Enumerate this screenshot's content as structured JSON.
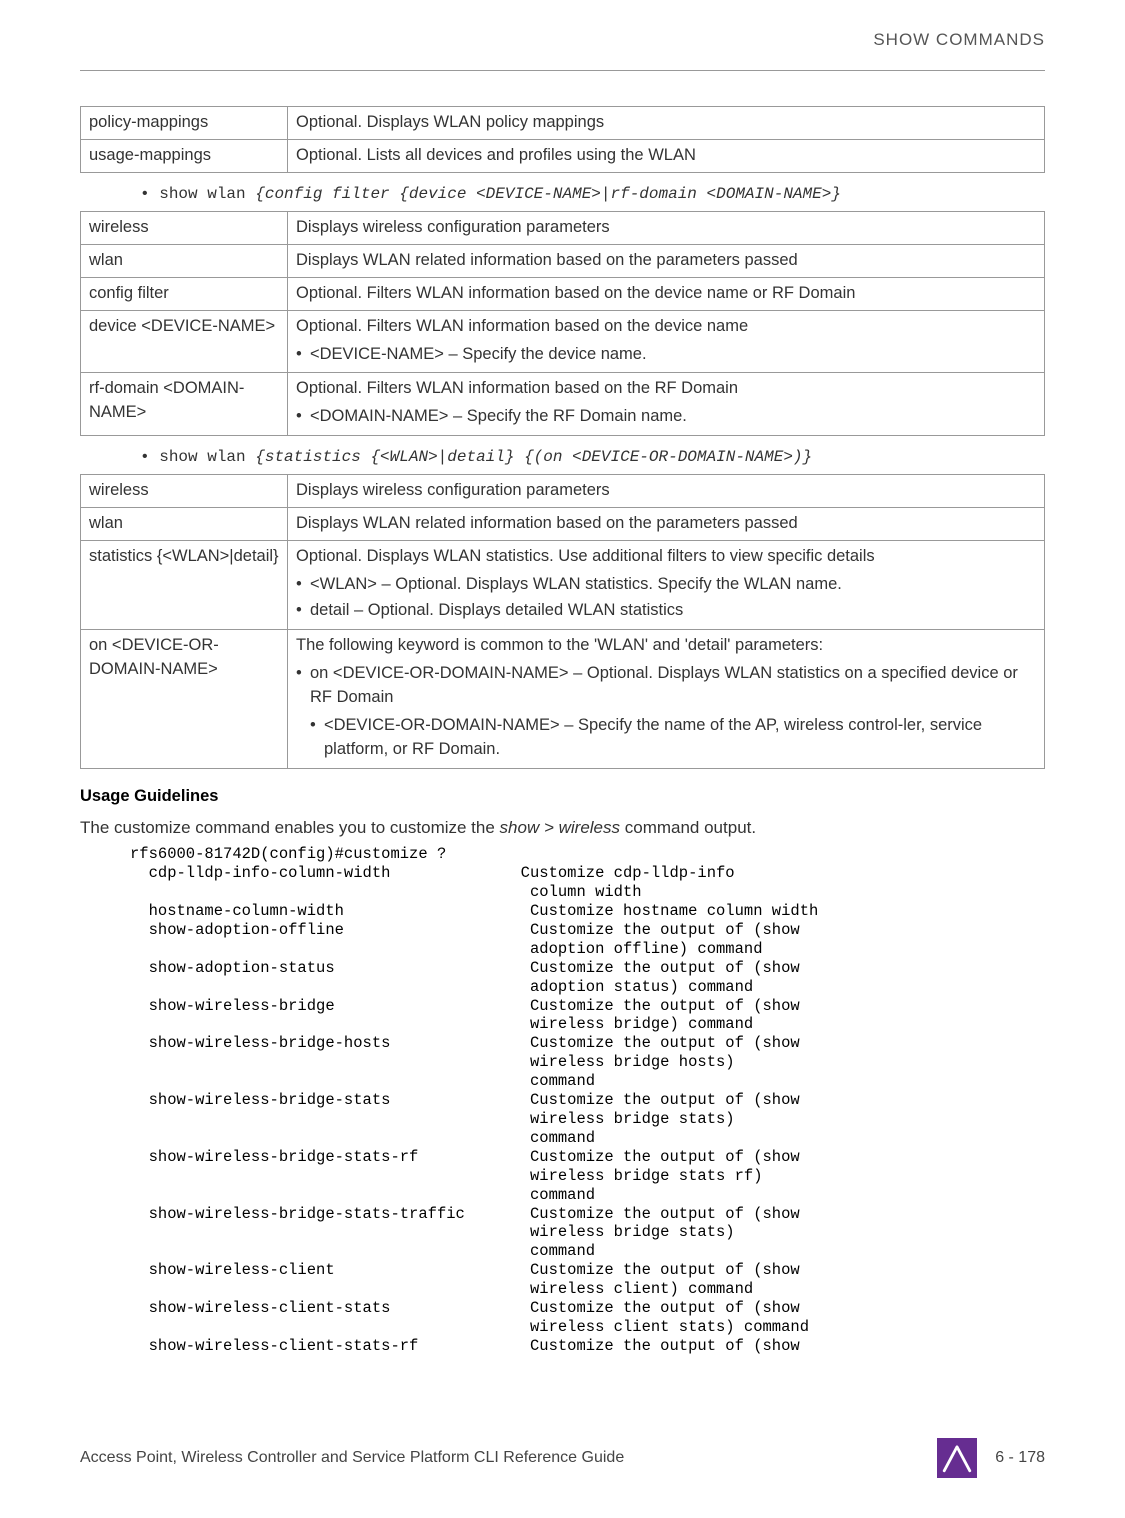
{
  "header": {
    "title": "SHOW COMMANDS"
  },
  "table1": {
    "rows": [
      {
        "c1": "policy-mappings",
        "c2": "Optional. Displays WLAN policy mappings"
      },
      {
        "c1": "usage-mappings",
        "c2": "Optional. Lists all devices and profiles using the WLAN"
      }
    ]
  },
  "cmd1": {
    "bullet": "•",
    "literal": "show wlan ",
    "italic": "{config filter {device <DEVICE-NAME>|rf-domain <DOMAIN-NAME>}"
  },
  "table2": {
    "rows": [
      {
        "c1": "wireless",
        "c2": "Displays wireless configuration parameters"
      },
      {
        "c1": "wlan",
        "c2": "Displays WLAN related information based on the parameters passed"
      },
      {
        "c1": "config filter",
        "c2": "Optional. Filters WLAN information based on the device name or RF Domain"
      },
      {
        "c1": "device <DEVICE-NAME>",
        "c2_main": "Optional. Filters WLAN information based on the device name",
        "c2_sub1": "<DEVICE-NAME> – Specify the device name."
      },
      {
        "c1": "rf-domain <DOMAIN-NAME>",
        "c2_main": "Optional. Filters WLAN information based on the RF Domain",
        "c2_sub1": "<DOMAIN-NAME> – Specify the RF Domain name."
      }
    ]
  },
  "cmd2": {
    "bullet": "•",
    "literal": "show wlan ",
    "italic": "{statistics {<WLAN>|detail} {(on <DEVICE-OR-DOMAIN-NAME>)}"
  },
  "table3": {
    "rows": [
      {
        "c1": "wireless",
        "c2": "Displays wireless configuration parameters"
      },
      {
        "c1": "wlan",
        "c2": "Displays WLAN related information based on the parameters passed"
      },
      {
        "c1": "statistics {<WLAN>|detail}",
        "c2_main": "Optional. Displays WLAN statistics. Use additional filters to view specific details",
        "c2_sub1": "<WLAN> – Optional. Displays WLAN statistics. Specify the WLAN name.",
        "c2_sub2": "detail – Optional. Displays detailed WLAN statistics"
      },
      {
        "c1": "on <DEVICE-OR-DOMAIN-NAME>",
        "c2_main": "The following keyword is common to the 'WLAN' and 'detail' parameters:",
        "c2_sub1": "on <DEVICE-OR-DOMAIN-NAME> – Optional. Displays WLAN statistics on a specified device or RF Domain",
        "c2_sub1a": "<DEVICE-OR-DOMAIN-NAME> – Specify the name of the AP, wireless control-ler, service platform, or RF Domain."
      }
    ]
  },
  "usage": {
    "heading": "Usage Guidelines",
    "text_pre": "The customize command enables you to customize the ",
    "text_italic": "show > wireless",
    "text_post": " command output."
  },
  "cli": "rfs6000-81742D(config)#customize ?\n  cdp-lldp-info-column-width              Customize cdp-lldp-info\n                                           column width\n  hostname-column-width                    Customize hostname column width\n  show-adoption-offline                    Customize the output of (show\n                                           adoption offline) command\n  show-adoption-status                     Customize the output of (show\n                                           adoption status) command\n  show-wireless-bridge                     Customize the output of (show\n                                           wireless bridge) command\n  show-wireless-bridge-hosts               Customize the output of (show\n                                           wireless bridge hosts)\n                                           command\n  show-wireless-bridge-stats               Customize the output of (show\n                                           wireless bridge stats)\n                                           command\n  show-wireless-bridge-stats-rf            Customize the output of (show\n                                           wireless bridge stats rf)\n                                           command\n  show-wireless-bridge-stats-traffic       Customize the output of (show\n                                           wireless bridge stats)\n                                           command\n  show-wireless-client                     Customize the output of (show\n                                           wireless client) command\n  show-wireless-client-stats               Customize the output of (show\n                                           wireless client stats) command\n  show-wireless-client-stats-rf            Customize the output of (show",
  "footer": {
    "left": "Access Point, Wireless Controller and Service Platform CLI Reference Guide",
    "page": "6 - 178"
  }
}
